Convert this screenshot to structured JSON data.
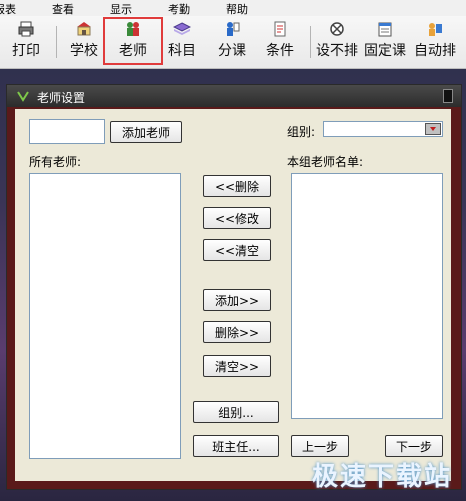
{
  "menubar": {
    "items": [
      "报表",
      "查看",
      "显示",
      "考勤",
      "帮助"
    ]
  },
  "toolbar": {
    "items": [
      {
        "label": "打印"
      },
      {
        "label": "学校"
      },
      {
        "label": "老师"
      },
      {
        "label": "科目"
      },
      {
        "label": "分课"
      },
      {
        "label": "条件"
      },
      {
        "label": "设不排"
      },
      {
        "label": "固定课"
      },
      {
        "label": "自动排"
      }
    ],
    "active": "老师"
  },
  "panel": {
    "title": "老师设置",
    "name_input_value": "",
    "add_button": "添加老师",
    "group_label": "组别:",
    "group_value": "",
    "all_teachers_label": "所有老师:",
    "group_list_label": "本组老师名单:",
    "all_teachers": [],
    "group_teachers": [],
    "buttons": {
      "remove_left": "<<删除",
      "edit_left": "<<修改",
      "clear_left": "<<清空",
      "add_right": "添加>>",
      "remove_right": "删除>>",
      "clear_right": "清空>>",
      "group": "组别...",
      "class_teacher": "班主任...",
      "prev": "上一步",
      "next": "下一步"
    }
  },
  "watermark": "极速下载站"
}
